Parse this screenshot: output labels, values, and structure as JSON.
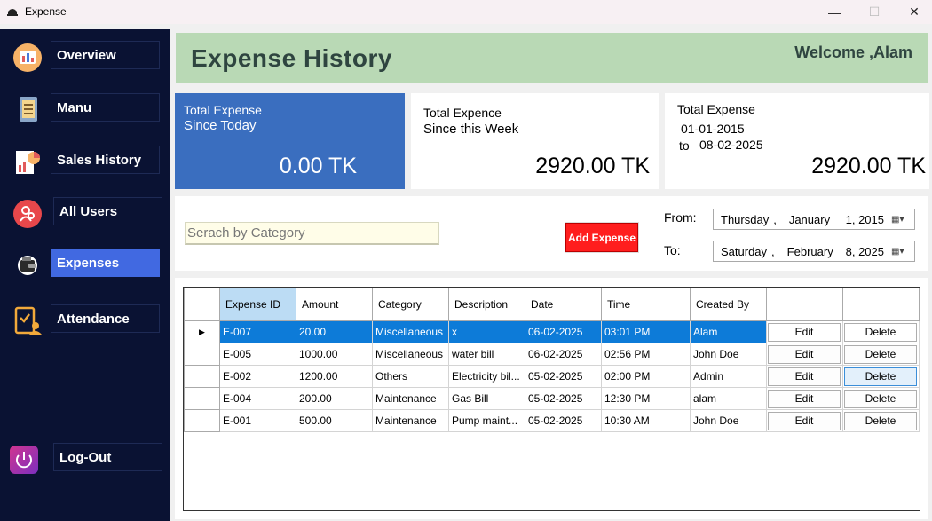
{
  "window": {
    "title": "Expense",
    "icon": "app-icon"
  },
  "sidebar": {
    "items": [
      {
        "label": "Overview",
        "icon": "overview-icon"
      },
      {
        "label": "Manu",
        "icon": "menu-icon"
      },
      {
        "label": "Sales History",
        "icon": "sales-history-icon"
      },
      {
        "label": "All Users",
        "icon": "users-icon"
      },
      {
        "label": "Expenses",
        "icon": "wallet-icon",
        "active": true
      },
      {
        "label": "Attendance",
        "icon": "attendance-icon"
      }
    ],
    "logout": {
      "label": "Log-Out",
      "icon": "power-icon"
    }
  },
  "header": {
    "title": "Expense History",
    "welcome": "Welcome ,Alam"
  },
  "cards": {
    "today": {
      "line1": "Total Expense",
      "line2": "Since Today",
      "amount": "0.00 TK"
    },
    "week": {
      "line1": "Total Expence",
      "line2": "Since this Week",
      "amount": "2920.00 TK"
    },
    "range": {
      "line1": "Total Expense",
      "from": "01-01-2015",
      "to_label": "to",
      "to": "08-02-2025",
      "amount": "2920.00 TK"
    }
  },
  "filters": {
    "search_placeholder": "Serach by Category",
    "add_button": "Add Expense",
    "from_label": "From:",
    "to_label": "To:",
    "from": {
      "weekday": "Thursday",
      "month": "January",
      "day_year": "1, 2015"
    },
    "to": {
      "weekday": "Saturday",
      "month": "February",
      "day_year": "8, 2025"
    }
  },
  "table": {
    "columns": [
      "Expense ID",
      "Amount",
      "Category",
      "Description",
      "Date",
      "Time",
      "Created By",
      "",
      ""
    ],
    "edit_label": "Edit",
    "delete_label": "Delete",
    "rows": [
      {
        "id": "E-007",
        "amount": "20.00",
        "category": "Miscellaneous",
        "description": "x",
        "date": "06-02-2025",
        "time": "03:01 PM",
        "created_by": "Alam",
        "selected": true
      },
      {
        "id": "E-005",
        "amount": "1000.00",
        "category": "Miscellaneous",
        "description": "water bill",
        "date": "06-02-2025",
        "time": "02:56 PM",
        "created_by": "John Doe"
      },
      {
        "id": "E-002",
        "amount": "1200.00",
        "category": "Others",
        "description": "Electricity bil...",
        "date": "05-02-2025",
        "time": "02:00 PM",
        "created_by": "Admin"
      },
      {
        "id": "E-004",
        "amount": "200.00",
        "category": "Maintenance",
        "description": "Gas Bill",
        "date": "05-02-2025",
        "time": "12:30 PM",
        "created_by": "alam"
      },
      {
        "id": "E-001",
        "amount": "500.00",
        "category": "Maintenance",
        "description": "Pump maint...",
        "date": "05-02-2025",
        "time": "10:30 AM",
        "created_by": "John Doe"
      }
    ]
  },
  "colors": {
    "sidebar": "#0a1233",
    "active_nav": "#4169e1",
    "header": "#b9d9b5",
    "today_card": "#3a6ebf",
    "add_button": "#ff1e1e",
    "selected_row": "#0d7bd8"
  }
}
